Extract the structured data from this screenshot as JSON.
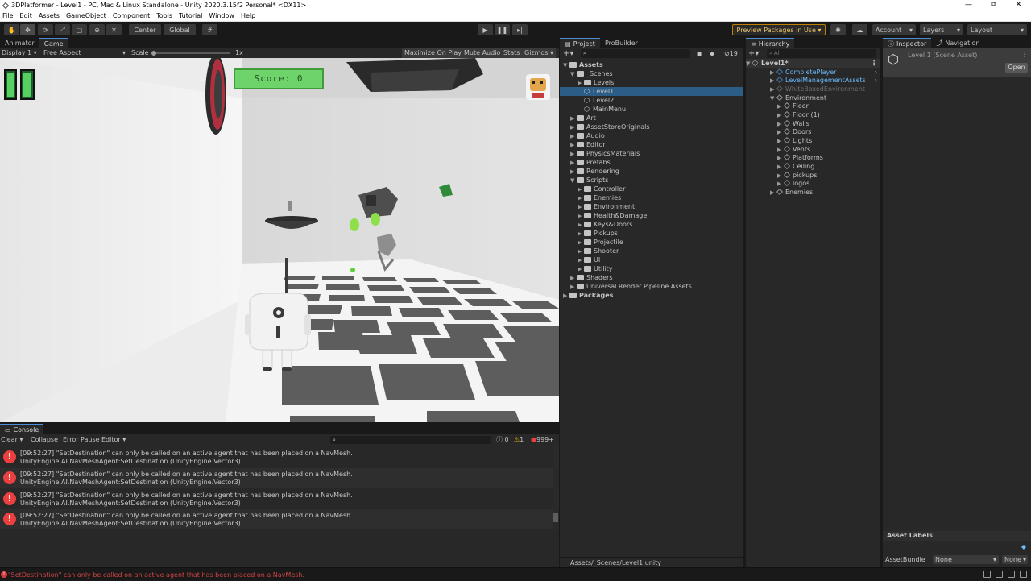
{
  "window": {
    "title": "3DPlatformer - Level1 - PC, Mac & Linux Standalone - Unity 2020.3.15f2 Personal* <DX11>",
    "minimize": "—",
    "maximize": "⧉",
    "close": "✕"
  },
  "menu": [
    "File",
    "Edit",
    "Assets",
    "GameObject",
    "Component",
    "Tools",
    "Tutorial",
    "Window",
    "Help"
  ],
  "toolbar": {
    "pivot": "Center",
    "space": "Global",
    "preview_packages": "Preview Packages in Use",
    "account": "Account",
    "layers": "Layers",
    "layout": "Layout"
  },
  "game_panel": {
    "tabs": [
      "Animator",
      "Game"
    ],
    "display": "Display 1",
    "aspect": "Free Aspect",
    "scale_label": "Scale",
    "scale_value": "1x",
    "maximize_on_play": "Maximize On Play",
    "mute_audio": "Mute Audio",
    "stats": "Stats",
    "gizmos": "Gizmos",
    "score_text": "Score: 0"
  },
  "project_panel": {
    "tabs": [
      "Project",
      "ProBuilder"
    ],
    "hidden_count": "19",
    "tree": [
      {
        "label": "Assets",
        "bold": true
      },
      {
        "label": "_Scenes"
      },
      {
        "label": "Levels"
      },
      {
        "label": "Level1",
        "selected": true
      },
      {
        "label": "Level2"
      },
      {
        "label": "MainMenu"
      },
      {
        "label": "Art"
      },
      {
        "label": "AssetStoreOriginals"
      },
      {
        "label": "Audio"
      },
      {
        "label": "Editor"
      },
      {
        "label": "PhysicsMaterials"
      },
      {
        "label": "Prefabs"
      },
      {
        "label": "Rendering"
      },
      {
        "label": "Scripts"
      },
      {
        "label": "Controller"
      },
      {
        "label": "Enemies"
      },
      {
        "label": "Environment"
      },
      {
        "label": "Health&Damage"
      },
      {
        "label": "Keys&Doors"
      },
      {
        "label": "Pickups"
      },
      {
        "label": "Projectile"
      },
      {
        "label": "Shooter"
      },
      {
        "label": "UI"
      },
      {
        "label": "Utility"
      },
      {
        "label": "Shaders"
      },
      {
        "label": "Universal Render Pipeline Assets"
      },
      {
        "label": "Packages",
        "bold": true
      }
    ],
    "path": "Assets/_Scenes/Level1.unity"
  },
  "hierarchy_panel": {
    "tab": "Hierarchy",
    "search_placeholder": "All",
    "tree": [
      {
        "label": "Level1*"
      },
      {
        "label": "CompletePlayer"
      },
      {
        "label": "LevelManagementAssets"
      },
      {
        "label": "WhiteBoxedEnvironment"
      },
      {
        "label": "Environment"
      },
      {
        "label": "Floor"
      },
      {
        "label": "Floor (1)"
      },
      {
        "label": "Walls"
      },
      {
        "label": "Doors"
      },
      {
        "label": "Lights"
      },
      {
        "label": "Vents"
      },
      {
        "label": "Platforms"
      },
      {
        "label": "Ceiling"
      },
      {
        "label": "pickups"
      },
      {
        "label": "logos"
      },
      {
        "label": "Enemies"
      }
    ]
  },
  "inspector_panel": {
    "tabs": [
      "Inspector",
      "Navigation"
    ],
    "asset_title": "Level 1 (Scene Asset)",
    "open_button": "Open",
    "asset_labels": "Asset Labels",
    "asset_bundle_label": "AssetBundle",
    "asset_bundle_value": "None",
    "variant_value": "None"
  },
  "console_panel": {
    "tab": "Console",
    "clear": "Clear",
    "collapse": "Collapse",
    "error_pause": "Error Pause",
    "editor": "Editor",
    "log_count": "0",
    "warning_count": "1",
    "error_count": "999+",
    "logs": [
      {
        "line1": "[09:52:27] \"SetDestination\" can only be called on an active agent that has been placed on a NavMesh.",
        "line2": "UnityEngine.AI.NavMeshAgent:SetDestination (UnityEngine.Vector3)"
      },
      {
        "line1": "[09:52:27] \"SetDestination\" can only be called on an active agent that has been placed on a NavMesh.",
        "line2": "UnityEngine.AI.NavMeshAgent:SetDestination (UnityEngine.Vector3)"
      },
      {
        "line1": "[09:52:27] \"SetDestination\" can only be called on an active agent that has been placed on a NavMesh.",
        "line2": "UnityEngine.AI.NavMeshAgent:SetDestination (UnityEngine.Vector3)"
      },
      {
        "line1": "[09:52:27] \"SetDestination\" can only be called on an active agent that has been placed on a NavMesh.",
        "line2": "UnityEngine.AI.NavMeshAgent:SetDestination (UnityEngine.Vector3)"
      }
    ]
  },
  "status_bar": {
    "message": "\"SetDestination\" can only be called on an active agent that has been placed on a NavMesh."
  },
  "colors": {
    "accent": "#4b8cd9",
    "selection": "#2c5d87",
    "error": "#ec4040",
    "warning": "#f5b400",
    "preview_border": "#c17f00",
    "score_green": "#6fd36b"
  },
  "icons": [
    "hand-icon",
    "move-icon",
    "rotate-icon",
    "scale-icon",
    "rect-icon",
    "transform-icon",
    "custom-tool-icon",
    "grid-snap-icon",
    "play-icon",
    "pause-icon",
    "step-icon",
    "lighting-icon",
    "cloud-icon",
    "unity-logo-icon",
    "error-icon",
    "warning-icon",
    "info-icon"
  ]
}
